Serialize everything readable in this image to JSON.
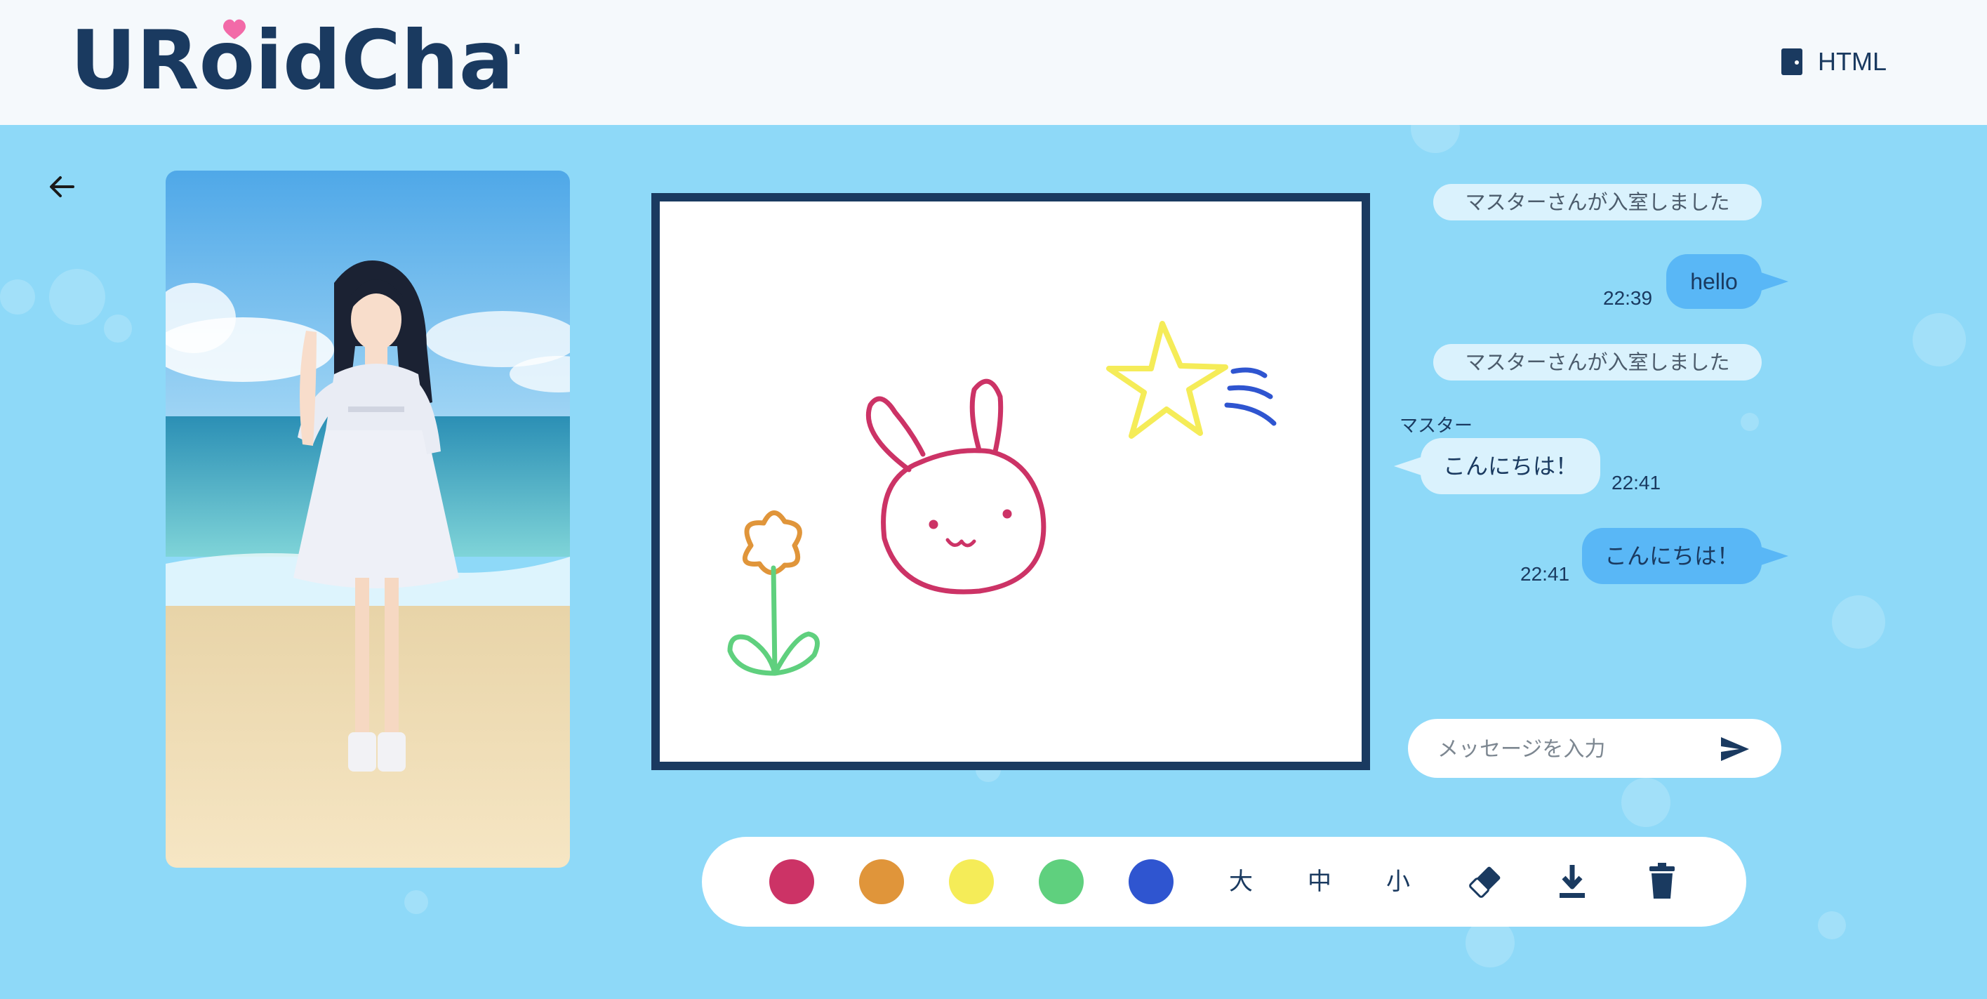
{
  "app": {
    "title": "URoidChat"
  },
  "header": {
    "room_button_label": "HTML"
  },
  "colors": {
    "navy": "#1a3a60",
    "sky": "#8ed9f8",
    "bubble_out": "#59b7f6",
    "bubble_in": "#daf2fd"
  },
  "toolbar": {
    "colors": [
      "#cc3366",
      "#e0953a",
      "#f5ec58",
      "#5fd07e",
      "#2f55d0"
    ],
    "sizes": [
      "大",
      "中",
      "小"
    ],
    "icons": [
      "eraser-icon",
      "download-icon",
      "trash-icon"
    ]
  },
  "chat": {
    "messages": [
      {
        "type": "system",
        "text": "マスターさんが入室しました"
      },
      {
        "type": "outgoing",
        "text": "hello",
        "time": "22:39"
      },
      {
        "type": "system",
        "text": "マスターさんが入室しました"
      },
      {
        "type": "incoming",
        "sender": "マスター",
        "text": "こんにちは！",
        "time": "22:41"
      },
      {
        "type": "outgoing",
        "text": "こんにちは！",
        "time": "22:41"
      }
    ],
    "input_placeholder": "メッセージを入力",
    "input_value": ""
  }
}
